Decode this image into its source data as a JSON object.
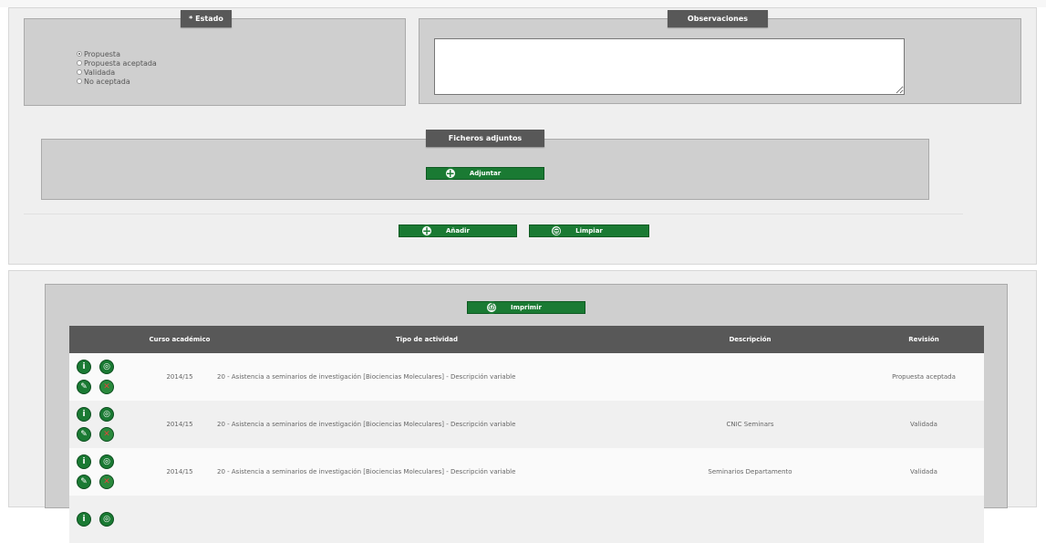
{
  "estado": {
    "legend": "* Estado",
    "options": [
      {
        "label": "Propuesta",
        "checked": true
      },
      {
        "label": "Propuesta aceptada",
        "checked": false
      },
      {
        "label": "Validada",
        "checked": false
      },
      {
        "label": "No aceptada",
        "checked": false
      }
    ]
  },
  "observaciones": {
    "legend": "Observaciones",
    "value": ""
  },
  "ficheros": {
    "legend": "Ficheros adjuntos",
    "adjuntar_label": "Adjuntar"
  },
  "actions": {
    "anadir_label": "Añadir",
    "limpiar_label": "Limpiar"
  },
  "list": {
    "imprimir_label": "Imprimir",
    "columns": {
      "curso": "Curso académico",
      "tipo": "Tipo de actividad",
      "descripcion": "Descripción",
      "revision": "Revisión"
    },
    "rows": [
      {
        "curso": "2014/15",
        "tipo": "20 - Asistencia a seminarios de investigación [Biociencias Moleculares] - Descripción variable",
        "descripcion": "",
        "revision": "Propuesta aceptada"
      },
      {
        "curso": "2014/15",
        "tipo": "20 - Asistencia a seminarios de investigación [Biociencias Moleculares] - Descripción variable",
        "descripcion": "CNIC Seminars",
        "revision": "Validada"
      },
      {
        "curso": "2014/15",
        "tipo": "20 - Asistencia a seminarios de investigación [Biociencias Moleculares] - Descripción variable",
        "descripcion": "Seminarios Departamento",
        "revision": "Validada"
      }
    ]
  },
  "icons": {
    "info": "i",
    "view": "◎",
    "edit": "✎",
    "delete": "✕",
    "add": "+",
    "clear": "⊜",
    "print": "⎙"
  },
  "colors": {
    "button_green": "#1a7a33",
    "header_dark": "#585858",
    "panel_gray": "#cfcfcf"
  }
}
